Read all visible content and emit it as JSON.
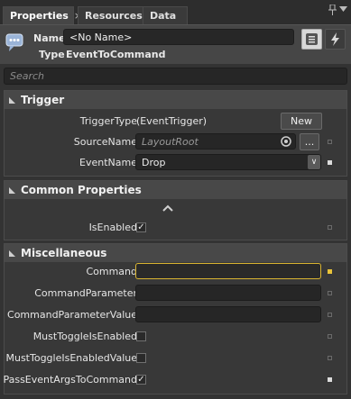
{
  "tabs": [
    {
      "label": "Properties",
      "active": true
    },
    {
      "label": "Resources",
      "active": false
    },
    {
      "label": "Data",
      "active": false
    }
  ],
  "tab_close": "×",
  "header": {
    "name_label": "Name",
    "name_value": "<No Name>",
    "type_label": "Type",
    "type_value": "EventToCommand"
  },
  "search_placeholder": "Search",
  "trigger": {
    "title": "Trigger",
    "trigger_type_label": "TriggerType",
    "trigger_type_value": "(EventTrigger)",
    "new_button": "New",
    "source_name_label": "SourceName",
    "source_name_value": "LayoutRoot",
    "browse_button": "...",
    "event_name_label": "EventName",
    "event_name_value": "Drop"
  },
  "common": {
    "title": "Common Properties",
    "is_enabled_label": "IsEnabled",
    "is_enabled": true
  },
  "misc": {
    "title": "Miscellaneous",
    "command_label": "Command",
    "command_value": "",
    "command_parameter_label": "CommandParameter",
    "command_parameter_value_label": "CommandParameterValue",
    "must_toggle_label": "MustToggleIsEnabled",
    "must_toggle": false,
    "must_toggle_value_label": "MustToggleIsEnabledValue",
    "must_toggle_value": false,
    "pass_event_args_label": "PassEventArgsToCommand",
    "pass_event_args": true
  },
  "colors": {
    "accent_focus": "#d9b431",
    "panel_bg": "#333333"
  }
}
